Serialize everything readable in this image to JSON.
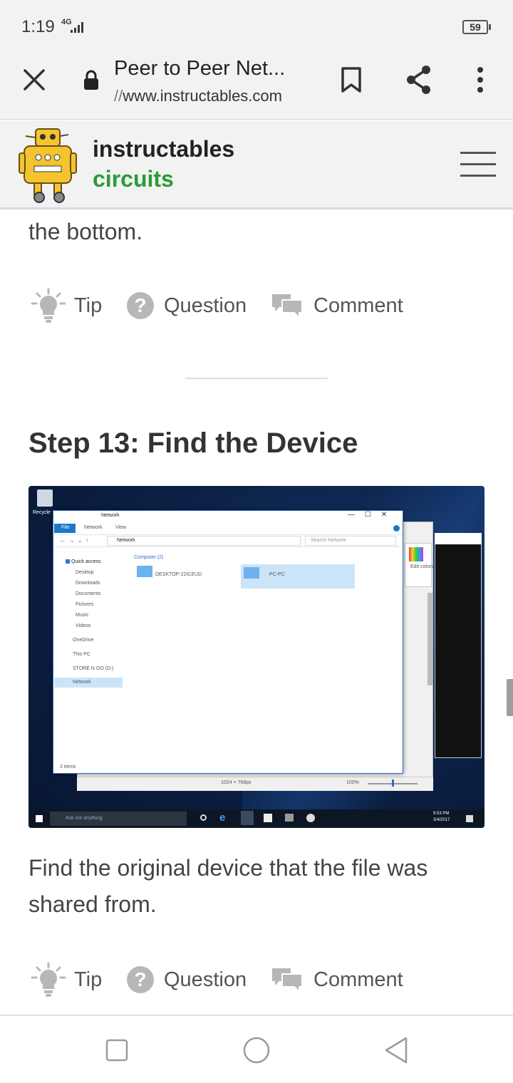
{
  "status_bar": {
    "time": "1:19",
    "network": "4G",
    "battery": "59"
  },
  "browser": {
    "page_title": "Peer to Peer Net...",
    "url_scheme": "//",
    "url_host": "www.instructables.com",
    "icons": [
      "close-icon",
      "lock-icon",
      "bookmark-icon",
      "share-icon",
      "more-vert-icon"
    ]
  },
  "site": {
    "brand": "instructables",
    "brand_sub": "circuits",
    "brand_sub_color": "#2b9b3a",
    "menu_icon": "hamburger-icon"
  },
  "content": {
    "prev_text": "the bottom.",
    "actions": {
      "tip": "Tip",
      "question": "Question",
      "comment": "Comment"
    },
    "step_title": "Step 13: Find the Device",
    "step_text": "Find the original device that the file was shared from."
  },
  "screenshot": {
    "window_title": "Network",
    "tab_file": "File",
    "tab_network": "Network",
    "tab_view": "View",
    "address": "Network",
    "search_placeholder": "Search Network",
    "group": "Computer (2)",
    "devices": [
      "DESKTOP-22ICEUD",
      "PC-PC"
    ],
    "nav_quick_access": "Quick access",
    "nav_items": [
      "Desktop",
      "Downloads",
      "Documents",
      "Pictures",
      "Music",
      "Videos"
    ],
    "nav_onedrive": "OneDrive",
    "nav_this_pc": "This PC",
    "nav_drive": "STORE N GO (D:)",
    "nav_network": "Network",
    "status_items": "2 items",
    "paint_size": "1024 × 768px",
    "paint_zoom": "100%",
    "paint_edit": "Edit colors",
    "recycle": "Recycle",
    "search_taskbar": "Ask me anything",
    "tray_time": "9:53 PM",
    "tray_date": "3/4/2017"
  },
  "navbar": {
    "icons": [
      "recents-square-icon",
      "home-circle-icon",
      "back-triangle-icon"
    ]
  }
}
